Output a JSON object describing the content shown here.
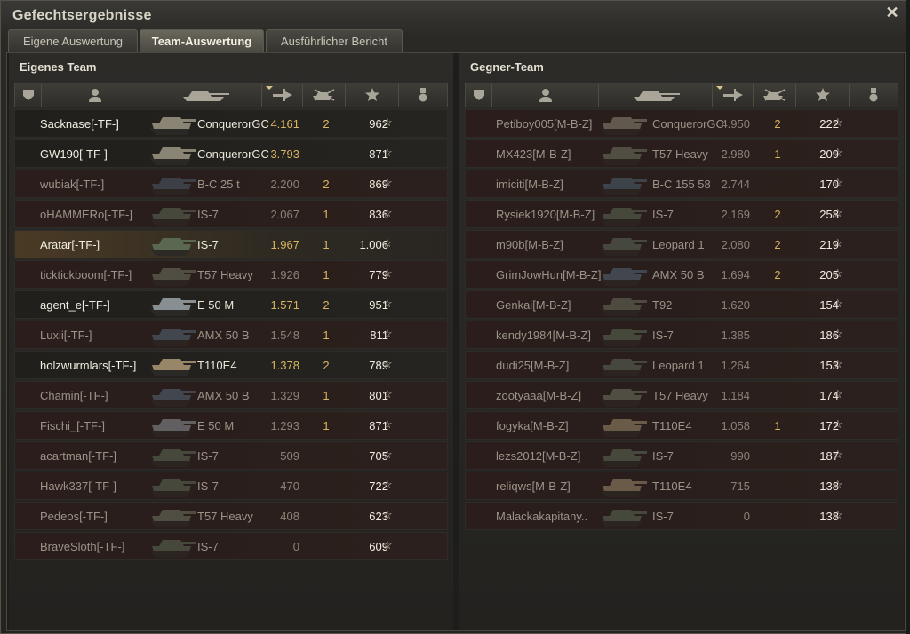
{
  "window": {
    "title": "Gefechtsergebnisse"
  },
  "tabs": [
    {
      "label": "Eigene Auswertung"
    },
    {
      "label": "Team-Auswertung"
    },
    {
      "label": "Ausführlicher Bericht"
    }
  ],
  "teams": {
    "own": {
      "title": "Eigenes Team",
      "rows": [
        {
          "name": "Sacknase[-TF-]",
          "vehicle": "ConquerorGC",
          "damage": "4.161",
          "kills": "2",
          "xp": "962",
          "status": "alive"
        },
        {
          "name": "GW190[-TF-]",
          "vehicle": "ConquerorGC",
          "damage": "3.793",
          "kills": "",
          "xp": "871",
          "status": "alive"
        },
        {
          "name": "wubiak[-TF-]",
          "vehicle": "B-C 25 t",
          "damage": "2.200",
          "kills": "2",
          "xp": "869",
          "status": "dead"
        },
        {
          "name": "oHAMMERo[-TF-]",
          "vehicle": "IS-7",
          "damage": "2.067",
          "kills": "1",
          "xp": "836",
          "status": "dead"
        },
        {
          "name": "Aratar[-TF-]",
          "vehicle": "IS-7",
          "damage": "1.967",
          "kills": "1",
          "xp": "1.006",
          "status": "player"
        },
        {
          "name": "ticktickboom[-TF-]",
          "vehicle": "T57 Heavy",
          "damage": "1.926",
          "kills": "1",
          "xp": "779",
          "status": "dead"
        },
        {
          "name": "agent_e[-TF-]",
          "vehicle": "E 50 M",
          "damage": "1.571",
          "kills": "2",
          "xp": "951",
          "status": "alive"
        },
        {
          "name": "Luxii[-TF-]",
          "vehicle": "AMX 50 B",
          "damage": "1.548",
          "kills": "1",
          "xp": "811",
          "status": "dead"
        },
        {
          "name": "holzwurmlars[-TF-]",
          "vehicle": "T110E4",
          "damage": "1.378",
          "kills": "2",
          "xp": "789",
          "status": "alive"
        },
        {
          "name": "Chamin[-TF-]",
          "vehicle": "AMX 50 B",
          "damage": "1.329",
          "kills": "1",
          "xp": "801",
          "status": "dead"
        },
        {
          "name": "Fischi_[-TF-]",
          "vehicle": "E 50 M",
          "damage": "1.293",
          "kills": "1",
          "xp": "871",
          "status": "dead"
        },
        {
          "name": "acartman[-TF-]",
          "vehicle": "IS-7",
          "damage": "509",
          "kills": "",
          "xp": "705",
          "status": "dead"
        },
        {
          "name": "Hawk337[-TF-]",
          "vehicle": "IS-7",
          "damage": "470",
          "kills": "",
          "xp": "722",
          "status": "dead"
        },
        {
          "name": "Pedeos[-TF-]",
          "vehicle": "T57 Heavy",
          "damage": "408",
          "kills": "",
          "xp": "623",
          "status": "dead"
        },
        {
          "name": "BraveSloth[-TF-]",
          "vehicle": "IS-7",
          "damage": "0",
          "kills": "",
          "xp": "609",
          "status": "dead"
        }
      ]
    },
    "enemy": {
      "title": "Gegner-Team",
      "rows": [
        {
          "name": "Petiboy005[M-B-Z]",
          "vehicle": "ConquerorGC",
          "damage": "4.950",
          "kills": "2",
          "xp": "222",
          "status": "dead"
        },
        {
          "name": "MX423[M-B-Z]",
          "vehicle": "T57 Heavy",
          "damage": "2.980",
          "kills": "1",
          "xp": "209",
          "status": "dead"
        },
        {
          "name": "imiciti[M-B-Z]",
          "vehicle": "B-C 155 58",
          "damage": "2.744",
          "kills": "",
          "xp": "170",
          "status": "dead"
        },
        {
          "name": "Rysiek1920[M-B-Z]",
          "vehicle": "IS-7",
          "damage": "2.169",
          "kills": "2",
          "xp": "258",
          "status": "dead"
        },
        {
          "name": "m90b[M-B-Z]",
          "vehicle": "Leopard 1",
          "damage": "2.080",
          "kills": "2",
          "xp": "219",
          "status": "dead"
        },
        {
          "name": "GrimJowHun[M-B-Z]",
          "vehicle": "AMX 50 B",
          "damage": "1.694",
          "kills": "2",
          "xp": "205",
          "status": "dead"
        },
        {
          "name": "Genkai[M-B-Z]",
          "vehicle": "T92",
          "damage": "1.620",
          "kills": "",
          "xp": "154",
          "status": "dead"
        },
        {
          "name": "kendy1984[M-B-Z]",
          "vehicle": "IS-7",
          "damage": "1.385",
          "kills": "",
          "xp": "186",
          "status": "dead"
        },
        {
          "name": "dudi25[M-B-Z]",
          "vehicle": "Leopard 1",
          "damage": "1.264",
          "kills": "",
          "xp": "153",
          "status": "dead"
        },
        {
          "name": "zootyaaa[M-B-Z]",
          "vehicle": "T57 Heavy",
          "damage": "1.184",
          "kills": "",
          "xp": "174",
          "status": "dead"
        },
        {
          "name": "fogyka[M-B-Z]",
          "vehicle": "T110E4",
          "damage": "1.058",
          "kills": "1",
          "xp": "172",
          "status": "dead"
        },
        {
          "name": "lezs2012[M-B-Z]",
          "vehicle": "IS-7",
          "damage": "990",
          "kills": "",
          "xp": "187",
          "status": "dead"
        },
        {
          "name": "reliqws[M-B-Z]",
          "vehicle": "T110E4",
          "damage": "715",
          "kills": "",
          "xp": "138",
          "status": "dead"
        },
        {
          "name": "Malackakapitany..",
          "vehicle": "IS-7",
          "damage": "0",
          "kills": "",
          "xp": "138",
          "status": "dead"
        }
      ]
    }
  },
  "icons": {
    "squad": "squad-icon",
    "player": "player-icon",
    "vehicle": "tank-icon",
    "damage": "damage-icon",
    "kills": "kills-icon",
    "xp": "star-icon",
    "medal": "medal-icon",
    "close": "close-icon"
  },
  "colors": {
    "gold": "#d8b560",
    "text": "#f2eee2",
    "dim": "#9a9488",
    "player_row": "#4a3a24"
  }
}
